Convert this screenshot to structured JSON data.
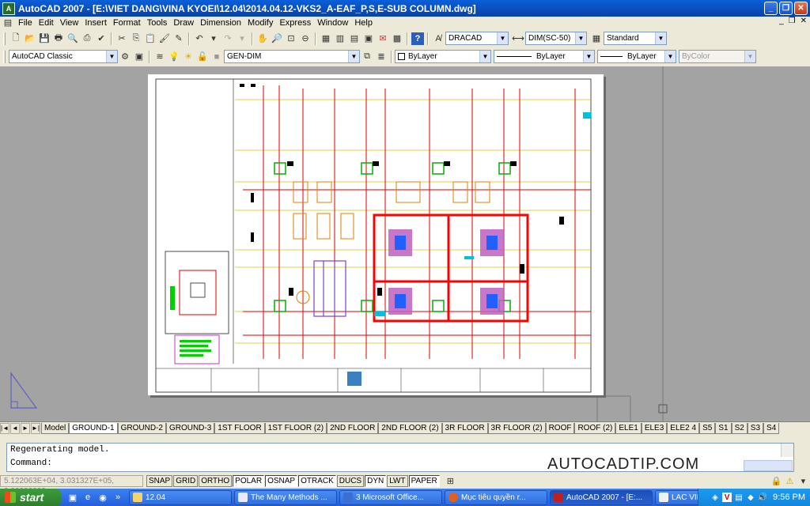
{
  "window": {
    "title": "AutoCAD 2007 - [E:\\VIET DANG\\VINA KYOEI\\12.04\\2014.04.12-VKS2_A-EAF_P,S,E-SUB COLUMN.dwg]",
    "app_icon": "A",
    "controls": [
      "_",
      "❐",
      "✕"
    ]
  },
  "menu": {
    "items": [
      "File",
      "Edit",
      "View",
      "Insert",
      "Format",
      "Tools",
      "Draw",
      "Dimension",
      "Modify",
      "Express",
      "Window",
      "Help"
    ],
    "mdi_controls": [
      "_",
      "❐",
      "✕"
    ]
  },
  "toolbar": {
    "text_style": "DRACAD",
    "dim_style": "DIM(SC-50)",
    "table_style": "Standard",
    "workspace": "AutoCAD Classic",
    "layer": "GEN-DIM",
    "color": "ByLayer",
    "linetype": "ByLayer",
    "lineweight": "ByLayer",
    "plotstyle": "ByColor"
  },
  "layout_tabs": {
    "nav": [
      "|◄",
      "◄",
      "►",
      "►|"
    ],
    "tabs": [
      "Model",
      "GROUND-1",
      "GROUND-2",
      "GROUND-3",
      "1ST FLOOR",
      "1ST FLOOR (2)",
      "2ND FLOOR",
      "2ND FLOOR (2)",
      "3R FLOOR",
      "3R FLOOR (2)",
      "ROOF",
      "ROOF (2)",
      "ELE1",
      "ELE3",
      "ELE2 4",
      "S5",
      "S1",
      "S2",
      "S3",
      "S4"
    ],
    "active": "GROUND-1"
  },
  "command_line": {
    "history": "Regenerating model.",
    "prompt": "Command:"
  },
  "watermark": "AUTOCADTIP.COM",
  "status": {
    "coordinates": "5.122063E+04, 3.031327E+05, 0.00000000",
    "toggles": [
      "SNAP",
      "GRID",
      "ORTHO",
      "POLAR",
      "OSNAP",
      "OTRACK",
      "DUCS",
      "DYN",
      "LWT",
      "PAPER"
    ],
    "active_toggles": [
      "POLAR",
      "OSNAP",
      "OTRACK",
      "DYN",
      "PAPER"
    ]
  },
  "taskbar": {
    "start_label": "start",
    "tasks": [
      "12.04",
      "The Many Methods ...",
      "3 Microsoft Office...",
      "Mục tiêu quyền r...",
      "AutoCAD 2007 - [E:...",
      "LAC VIET - MULTIM..."
    ],
    "active_task": "AutoCAD 2007 - [E:...",
    "clock": "9:56 PM"
  }
}
